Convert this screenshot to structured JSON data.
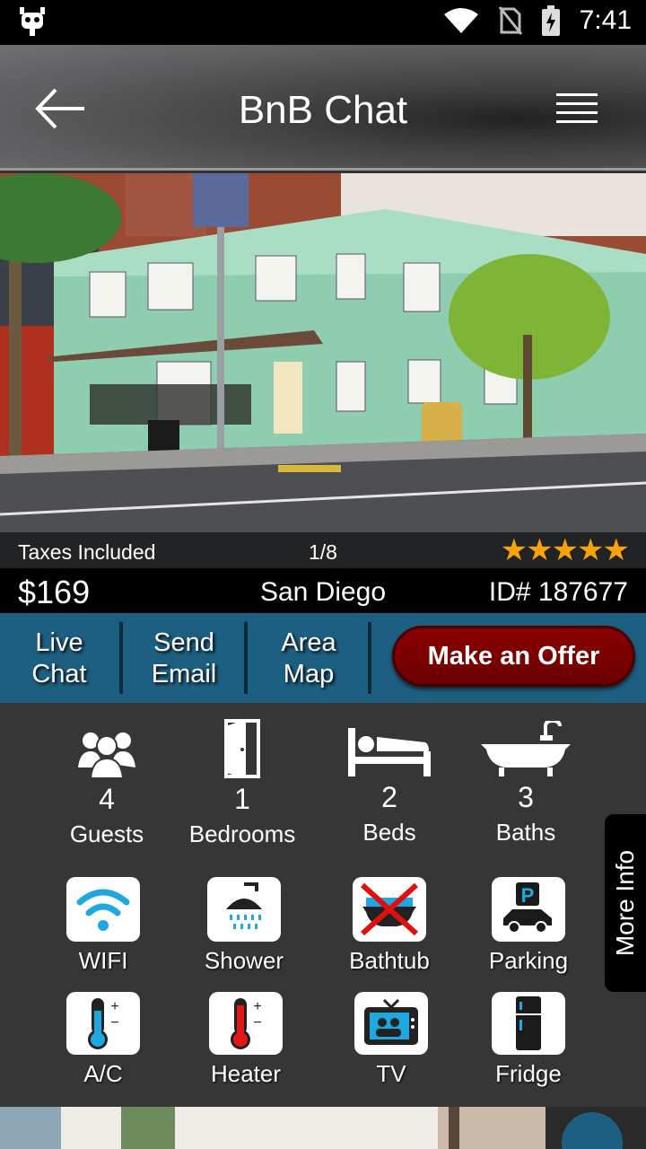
{
  "status_bar": {
    "time": "7:41",
    "icons": [
      "cyanogen-robot-icon",
      "wifi-icon",
      "no-sim-icon",
      "battery-charging-icon"
    ]
  },
  "app_bar": {
    "title": "BnB Chat",
    "back_icon": "back-arrow-icon",
    "menu_icon": "hamburger-menu-icon"
  },
  "listing": {
    "caption_left": "Taxes Included",
    "photo_counter": "1/8",
    "rating_stars": "★★★★★",
    "rating": 5,
    "price": "$169",
    "city": "San Diego",
    "id": "ID# 187677"
  },
  "actions": {
    "live_chat": [
      "Live",
      "Chat"
    ],
    "send_email": [
      "Send",
      "Email"
    ],
    "area_map": [
      "Area",
      "Map"
    ],
    "offer": "Make an Offer"
  },
  "stats": [
    {
      "icon": "guests-icon",
      "value": "4",
      "label": "Guests"
    },
    {
      "icon": "door-icon",
      "value": "1",
      "label": "Bedrooms"
    },
    {
      "icon": "bed-icon",
      "value": "2",
      "label": "Beds"
    },
    {
      "icon": "bathtub-icon",
      "value": "3",
      "label": "Baths"
    }
  ],
  "amenities": [
    {
      "icon": "wifi-icon",
      "label": "WIFI"
    },
    {
      "icon": "shower-icon",
      "label": "Shower"
    },
    {
      "icon": "no-bathtub-icon",
      "label": "Bathtub"
    },
    {
      "icon": "parking-icon",
      "label": "Parking"
    },
    {
      "icon": "cool-thermometer-icon",
      "label": "A/C"
    },
    {
      "icon": "heater-thermometer-icon",
      "label": "Heater"
    },
    {
      "icon": "tv-icon",
      "label": "TV"
    },
    {
      "icon": "fridge-icon",
      "label": "Fridge"
    }
  ],
  "more_info": "More Info",
  "colors": {
    "accent_bar": "#1d5f80",
    "offer_button": "#8b0000",
    "stars": "#f7a10c",
    "panel": "#363636"
  }
}
